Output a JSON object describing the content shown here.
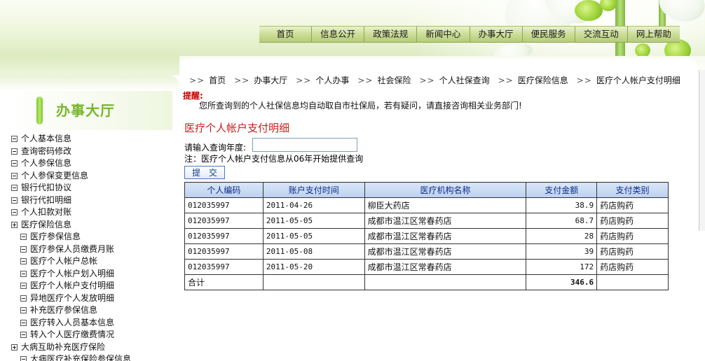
{
  "nav": [
    "首页",
    "信息公开",
    "政策法规",
    "新闻中心",
    "办事大厅",
    "便民服务",
    "交流互动",
    "网上帮助"
  ],
  "sidebar": {
    "title": "办事大厅",
    "items": [
      {
        "label": "个人基本信息",
        "icon": "minus-box-icon",
        "child": false
      },
      {
        "label": "查询密码修改",
        "icon": "minus-box-icon",
        "child": false
      },
      {
        "label": "个人参保信息",
        "icon": "minus-box-icon",
        "child": false
      },
      {
        "label": "个人参保变更信息",
        "icon": "minus-box-icon",
        "child": false
      },
      {
        "label": "银行代扣协议",
        "icon": "minus-box-icon",
        "child": false
      },
      {
        "label": "银行代扣明细",
        "icon": "minus-box-icon",
        "child": false
      },
      {
        "label": "个人扣款对账",
        "icon": "minus-box-icon",
        "child": false
      },
      {
        "label": "医疗保险信息",
        "icon": "plus-box-icon",
        "child": false
      },
      {
        "label": "医疗参保信息",
        "icon": "minus-box-icon",
        "child": true
      },
      {
        "label": "医疗参保人员缴费月账",
        "icon": "minus-box-icon",
        "child": true
      },
      {
        "label": "医疗个人帐户总帐",
        "icon": "minus-box-icon",
        "child": true
      },
      {
        "label": "医疗个人帐户划入明细",
        "icon": "minus-box-icon",
        "child": true
      },
      {
        "label": "医疗个人帐户支付明细",
        "icon": "minus-box-icon",
        "child": true
      },
      {
        "label": "异地医疗个人发放明细",
        "icon": "minus-box-icon",
        "child": true
      },
      {
        "label": "补充医疗参保信息",
        "icon": "minus-box-icon",
        "child": true
      },
      {
        "label": "医疗转入人员基本信息",
        "icon": "minus-box-icon",
        "child": true
      },
      {
        "label": "转入个人医疗缴费情况",
        "icon": "minus-box-icon",
        "child": true
      },
      {
        "label": "大病互助补充医疗保险",
        "icon": "plus-box-icon",
        "child": false
      },
      {
        "label": "大病医疗补充保险参保信息",
        "icon": "minus-box-icon",
        "child": true
      }
    ]
  },
  "breadcrumb": {
    "separator": ">>",
    "items": [
      "首页",
      "办事大厅",
      "个人办事",
      "社会保险",
      "个人社保查询",
      "医疗保险信息",
      "医疗个人帐户支付明细"
    ]
  },
  "notice": {
    "label": "提醒:",
    "text": "您所查询到的个人社保信息均自动取自市社保局，若有疑问，请直接咨询相关业务部门!"
  },
  "form": {
    "section_title": "医疗个人帐户支付明细",
    "year_label": "请输入查询年度:",
    "year_value": "",
    "note": "注：医疗个人帐户支付信息从06年开始提供查询",
    "submit_label": "提 交"
  },
  "table": {
    "headers": [
      "个人编码",
      "账户支付时间",
      "医疗机构名称",
      "支付金额",
      "支付类别"
    ],
    "rows": [
      [
        "012035997",
        "2011-04-26",
        "柳臣大药店",
        "38.9",
        "药店购药"
      ],
      [
        "012035997",
        "2011-05-05",
        "成都市温江区常春药店",
        "68.7",
        "药店购药"
      ],
      [
        "012035997",
        "2011-05-05",
        "成都市温江区常春药店",
        "28",
        "药店购药"
      ],
      [
        "012035997",
        "2011-05-08",
        "成都市温江区常春药店",
        "39",
        "药店购药"
      ],
      [
        "012035997",
        "2011-05-20",
        "成都市温江区常春药店",
        "172",
        "药店购药"
      ]
    ],
    "total_label": "合计",
    "total_value": "346.6"
  },
  "colors": {
    "nav_bar": "#c9dc94",
    "sidebar_title": "#78b62a",
    "section_title": "#c81e1e",
    "notice_label": "#cc0000",
    "table_header": "#bcd1f0",
    "table_header_text": "#0d2a88"
  }
}
